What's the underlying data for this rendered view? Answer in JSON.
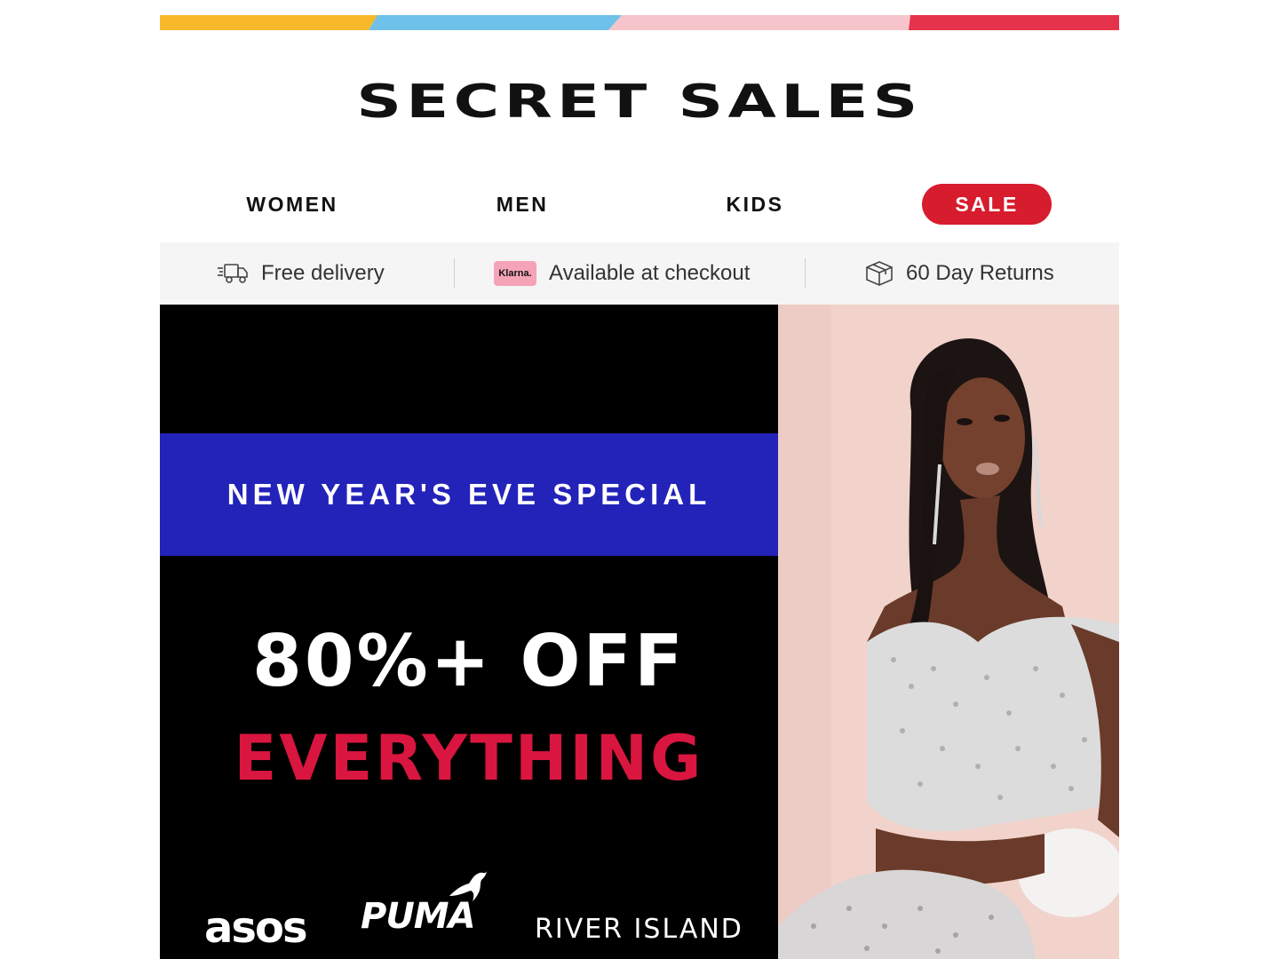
{
  "colors": {
    "stripe": [
      "#f7b92a",
      "#6ec1e8",
      "#f6c5cc",
      "#e5334b"
    ],
    "sale": "#d71c2d",
    "band": "#2323b9",
    "accent_headline": "#d9163f"
  },
  "header": {
    "logo": "SECRET SALES"
  },
  "nav": {
    "items": [
      {
        "label": "WOMEN"
      },
      {
        "label": "MEN"
      },
      {
        "label": "KIDS"
      },
      {
        "label": "SALE"
      }
    ]
  },
  "benefits": [
    {
      "icon": "delivery-truck-icon",
      "label": "Free delivery"
    },
    {
      "icon": "klarna-badge",
      "badge": "Klarna.",
      "label": "Available at checkout"
    },
    {
      "icon": "box-icon",
      "label": "60 Day Returns"
    }
  ],
  "hero": {
    "banner": "NEW YEAR'S EVE SPECIAL",
    "headline_line1": "80%+ OFF",
    "headline_line2": "EVERYTHING",
    "brands": [
      "asos",
      "PUMA",
      "RIVER ISLAND"
    ]
  }
}
